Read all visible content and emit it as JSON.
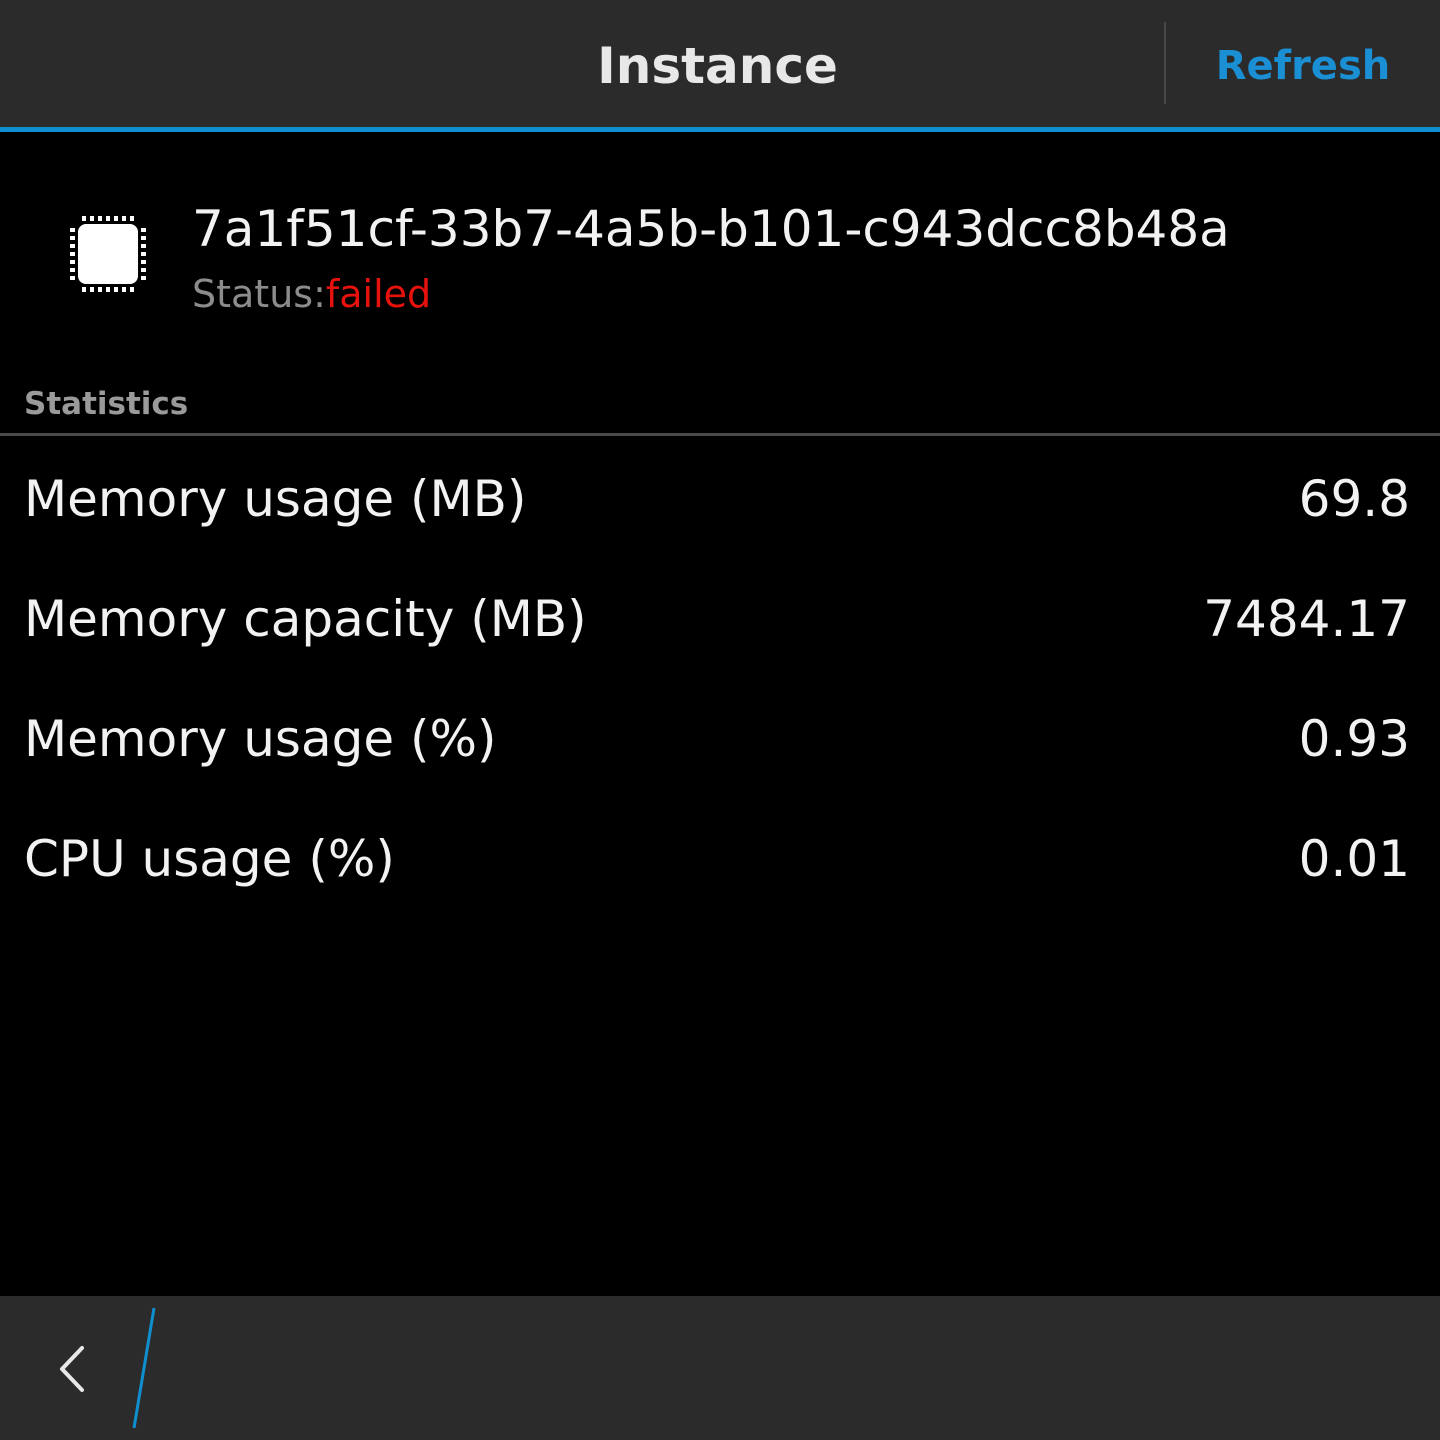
{
  "header": {
    "title": "Instance",
    "refresh_label": "Refresh"
  },
  "instance": {
    "id": "7a1f51cf-33b7-4a5b-b101-c943dcc8b48a",
    "status_label": "Status:",
    "status_value": "failed",
    "icon": "chip-icon"
  },
  "statistics": {
    "header": "Statistics",
    "rows": [
      {
        "label": "Memory usage (MB)",
        "value": "69.8"
      },
      {
        "label": "Memory capacity (MB)",
        "value": "7484.17"
      },
      {
        "label": "Memory usage (%)",
        "value": "0.93"
      },
      {
        "label": "CPU usage (%)",
        "value": "0.01"
      }
    ]
  },
  "footer": {
    "back_icon": "chevron-left-icon"
  },
  "colors": {
    "accent": "#0f8fd0",
    "refresh": "#1a8fd3",
    "status_failed": "#e8120c",
    "bar_background": "#2b2b2b",
    "background": "#000000"
  }
}
